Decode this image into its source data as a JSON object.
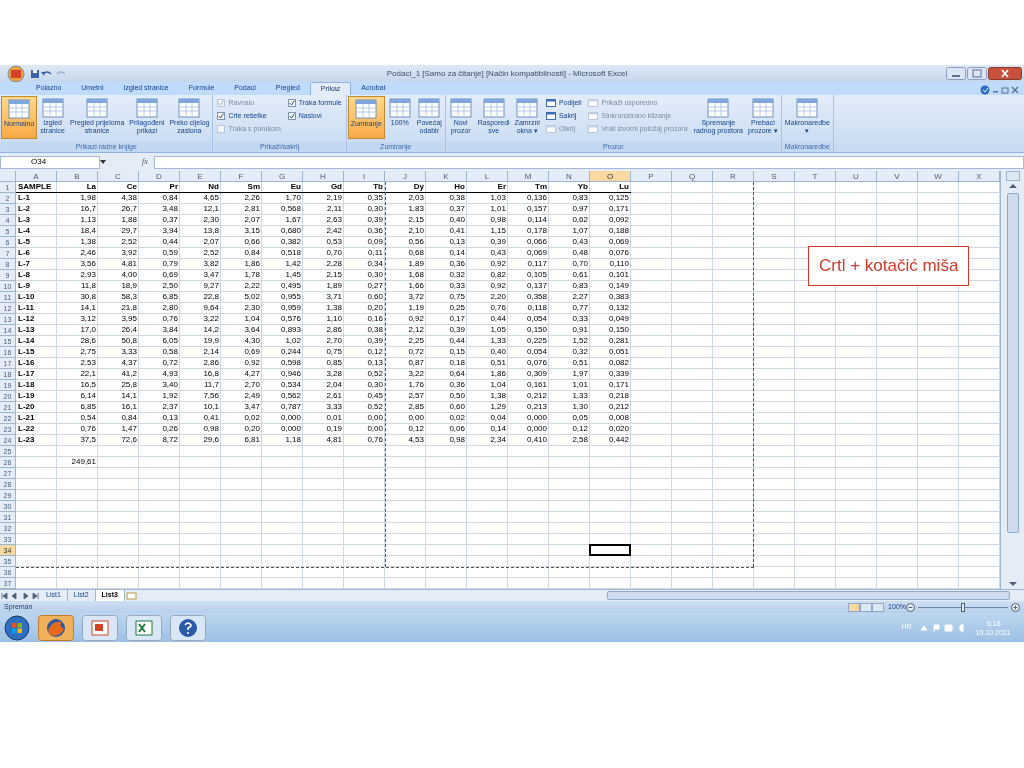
{
  "window": {
    "title": "Podaci_1  [Samo za čitanje]  [Način kompatibilnosti] - Microsoft Excel"
  },
  "tabs": [
    {
      "label": "Polazno",
      "selected": false
    },
    {
      "label": "Umetni",
      "selected": false
    },
    {
      "label": "Izgled stranice",
      "selected": false
    },
    {
      "label": "Formule",
      "selected": false
    },
    {
      "label": "Podaci",
      "selected": false
    },
    {
      "label": "Pregled",
      "selected": false
    },
    {
      "label": "Prikaz",
      "selected": true
    },
    {
      "label": "Acrobat",
      "selected": false
    }
  ],
  "ribbon": {
    "groups": [
      {
        "title": "Prikazi radne knjige",
        "items": [
          {
            "kind": "large",
            "lines": [
              "Normalno"
            ],
            "selected": true
          },
          {
            "kind": "large",
            "lines": [
              "Izgled",
              "stranice"
            ],
            "selected": false
          },
          {
            "kind": "large",
            "lines": [
              "Pregled prijeloma",
              "stranice"
            ],
            "selected": false
          },
          {
            "kind": "large",
            "lines": [
              "Prilagođeni",
              "prikazi"
            ],
            "selected": false
          },
          {
            "kind": "large",
            "lines": [
              "Preko cijelog",
              "zaslona"
            ],
            "selected": false
          }
        ]
      },
      {
        "title": "Prikaži/sakrij",
        "items": [
          {
            "kind": "stack",
            "items": [
              {
                "kind": "check",
                "label": "Ravnalo",
                "checked": true,
                "disabled": true
              },
              {
                "kind": "check",
                "label": "Crte rešetke",
                "checked": true,
                "disabled": false
              },
              {
                "kind": "check",
                "label": "Traka s porukom",
                "checked": false,
                "disabled": true
              }
            ]
          },
          {
            "kind": "stack",
            "items": [
              {
                "kind": "check",
                "label": "Traka formule",
                "checked": true,
                "disabled": false
              },
              {
                "kind": "check",
                "label": "Naslovi",
                "checked": true,
                "disabled": false
              }
            ]
          }
        ]
      },
      {
        "title": "Zumiranje",
        "items": [
          {
            "kind": "large",
            "lines": [
              "Zumiranje"
            ],
            "selected": true
          },
          {
            "kind": "large",
            "lines": [
              "100%"
            ],
            "selected": false
          },
          {
            "kind": "large",
            "lines": [
              "Povećaj",
              "odabir"
            ],
            "selected": false
          }
        ]
      },
      {
        "title": "Prozor",
        "items": [
          {
            "kind": "large",
            "lines": [
              "Novi",
              "prozor"
            ],
            "selected": false
          },
          {
            "kind": "large",
            "lines": [
              "Rasporedi",
              "sve"
            ],
            "selected": false
          },
          {
            "kind": "large",
            "lines": [
              "Zamrzni",
              "okna ▾"
            ],
            "selected": false
          },
          {
            "kind": "stack",
            "items": [
              {
                "kind": "small",
                "label": "Podijeli",
                "disabled": false
              },
              {
                "kind": "small",
                "label": "Sakrij",
                "disabled": false
              },
              {
                "kind": "small",
                "label": "Otkrij",
                "disabled": true
              }
            ]
          },
          {
            "kind": "stack",
            "items": [
              {
                "kind": "small",
                "label": "Prikaži usporedno",
                "disabled": true
              },
              {
                "kind": "small",
                "label": "Sinkronizirano klizanje",
                "disabled": true
              },
              {
                "kind": "small",
                "label": "Vrati izvorni položaj prozora",
                "disabled": true
              }
            ]
          },
          {
            "kind": "large",
            "lines": [
              "Spremanje",
              "radnog prostora"
            ],
            "selected": false
          },
          {
            "kind": "large",
            "lines": [
              "Prebaci",
              "prozore ▾"
            ],
            "selected": false
          }
        ]
      },
      {
        "title": "Makronaredbe",
        "items": [
          {
            "kind": "large",
            "lines": [
              "Makronaredbe",
              "▾"
            ],
            "selected": false
          }
        ]
      }
    ]
  },
  "formula_bar": {
    "name_box": "O34",
    "function_label": "fx"
  },
  "sheet": {
    "columns": [
      {
        "label": "A",
        "selected": false
      },
      {
        "label": "B",
        "selected": false
      },
      {
        "label": "C",
        "selected": false
      },
      {
        "label": "D",
        "selected": false
      },
      {
        "label": "E",
        "selected": false
      },
      {
        "label": "F",
        "selected": false
      },
      {
        "label": "G",
        "selected": false
      },
      {
        "label": "H",
        "selected": false
      },
      {
        "label": "I",
        "selected": false
      },
      {
        "label": "J",
        "selected": false
      },
      {
        "label": "K",
        "selected": false
      },
      {
        "label": "L",
        "selected": false
      },
      {
        "label": "M",
        "selected": false
      },
      {
        "label": "N",
        "selected": false
      },
      {
        "label": "O",
        "selected": true
      },
      {
        "label": "P",
        "selected": false
      },
      {
        "label": "Q",
        "selected": false
      },
      {
        "label": "R",
        "selected": false
      },
      {
        "label": "S",
        "selected": false
      },
      {
        "label": "T",
        "selected": false
      },
      {
        "label": "U",
        "selected": false
      },
      {
        "label": "V",
        "selected": false
      },
      {
        "label": "W",
        "selected": false
      },
      {
        "label": "X",
        "selected": false
      }
    ],
    "rows": [
      {
        "number": "1",
        "selected": false,
        "cells": [
          "SAMPLE",
          "La",
          "Ce",
          "Pr",
          "Nd",
          "Sm",
          "Eu",
          "Gd",
          "Tb",
          "Dy",
          "Ho",
          "Er",
          "Tm",
          "Yb",
          "Lu"
        ]
      },
      {
        "number": "2",
        "selected": false,
        "cells": [
          "L-1",
          "1,98",
          "4,38",
          "0,84",
          "4,65",
          "2,26",
          "1,70",
          "2,19",
          "0,35",
          "2,03",
          "0,38",
          "1,03",
          "0,136",
          "0,83",
          "0,125"
        ]
      },
      {
        "number": "3",
        "selected": false,
        "cells": [
          "L-2",
          "16,7",
          "26,7",
          "3,48",
          "12,1",
          "2,81",
          "0,568",
          "2,11",
          "0,30",
          "1,83",
          "0,37",
          "1,01",
          "0,157",
          "0,97",
          "0,171"
        ]
      },
      {
        "number": "4",
        "selected": false,
        "cells": [
          "L-3",
          "1,13",
          "1,88",
          "0,37",
          "2,30",
          "2,07",
          "1,67",
          "2,63",
          "0,39",
          "2,15",
          "0,40",
          "0,98",
          "0,114",
          "0,62",
          "0,092"
        ]
      },
      {
        "number": "5",
        "selected": false,
        "cells": [
          "L-4",
          "18,4",
          "29,7",
          "3,94",
          "13,8",
          "3,15",
          "0,680",
          "2,42",
          "0,36",
          "2,10",
          "0,41",
          "1,15",
          "0,178",
          "1,07",
          "0,188"
        ]
      },
      {
        "number": "6",
        "selected": false,
        "cells": [
          "L-5",
          "1,38",
          "2,52",
          "0,44",
          "2,07",
          "0,66",
          "0,382",
          "0,53",
          "0,09",
          "0,56",
          "0,13",
          "0,39",
          "0,066",
          "0,43",
          "0,069"
        ]
      },
      {
        "number": "7",
        "selected": false,
        "cells": [
          "L-6",
          "2,46",
          "3,92",
          "0,59",
          "2,52",
          "0,84",
          "0,518",
          "0,70",
          "0,11",
          "0,68",
          "0,14",
          "0,43",
          "0,069",
          "0,48",
          "0,076"
        ]
      },
      {
        "number": "8",
        "selected": false,
        "cells": [
          "L-7",
          "3,56",
          "4,81",
          "0,79",
          "3,82",
          "1,86",
          "1,42",
          "2,28",
          "0,34",
          "1,89",
          "0,36",
          "0,92",
          "0,117",
          "0,70",
          "0,110"
        ]
      },
      {
        "number": "9",
        "selected": false,
        "cells": [
          "L-8",
          "2,93",
          "4,00",
          "0,69",
          "3,47",
          "1,78",
          "1,45",
          "2,15",
          "0,30",
          "1,68",
          "0,32",
          "0,82",
          "0,105",
          "0,61",
          "0,101"
        ]
      },
      {
        "number": "10",
        "selected": false,
        "cells": [
          "L-9",
          "11,8",
          "18,9",
          "2,50",
          "9,27",
          "2,22",
          "0,495",
          "1,89",
          "0,27",
          "1,66",
          "0,33",
          "0,92",
          "0,137",
          "0,83",
          "0,149"
        ]
      },
      {
        "number": "11",
        "selected": false,
        "cells": [
          "L-10",
          "30,8",
          "58,3",
          "6,85",
          "22,8",
          "5,02",
          "0,955",
          "3,71",
          "0,60",
          "3,72",
          "0,75",
          "2,20",
          "0,358",
          "2,27",
          "0,383"
        ]
      },
      {
        "number": "12",
        "selected": false,
        "cells": [
          "L-11",
          "14,1",
          "21,8",
          "2,80",
          "9,64",
          "2,30",
          "0,959",
          "1,38",
          "0,20",
          "1,19",
          "0,25",
          "0,76",
          "0,118",
          "0,77",
          "0,132"
        ]
      },
      {
        "number": "13",
        "selected": false,
        "cells": [
          "L-12",
          "3,12",
          "3,95",
          "0,76",
          "3,22",
          "1,04",
          "0,576",
          "1,10",
          "0,16",
          "0,92",
          "0,17",
          "0,44",
          "0,054",
          "0,33",
          "0,049"
        ]
      },
      {
        "number": "14",
        "selected": false,
        "cells": [
          "L-13",
          "17,0",
          "26,4",
          "3,84",
          "14,2",
          "3,64",
          "0,893",
          "2,86",
          "0,38",
          "2,12",
          "0,39",
          "1,05",
          "0,150",
          "0,91",
          "0,150"
        ]
      },
      {
        "number": "15",
        "selected": false,
        "cells": [
          "L-14",
          "28,6",
          "50,8",
          "6,05",
          "19,9",
          "4,30",
          "1,02",
          "2,70",
          "0,39",
          "2,25",
          "0,44",
          "1,33",
          "0,225",
          "1,52",
          "0,281"
        ]
      },
      {
        "number": "16",
        "selected": false,
        "cells": [
          "L-15",
          "2,75",
          "3,33",
          "0,58",
          "2,14",
          "0,69",
          "0,244",
          "0,75",
          "0,12",
          "0,72",
          "0,15",
          "0,40",
          "0,054",
          "0,32",
          "0,051"
        ]
      },
      {
        "number": "17",
        "selected": false,
        "cells": [
          "L-16",
          "2,53",
          "4,37",
          "0,72",
          "2,86",
          "0,92",
          "0,598",
          "0,85",
          "0,13",
          "0,87",
          "0,18",
          "0,51",
          "0,076",
          "0,51",
          "0,082"
        ]
      },
      {
        "number": "18",
        "selected": false,
        "cells": [
          "L-17",
          "22,1",
          "41,2",
          "4,93",
          "16,8",
          "4,27",
          "0,946",
          "3,28",
          "0,52",
          "3,22",
          "0,64",
          "1,86",
          "0,309",
          "1,97",
          "0,339"
        ]
      },
      {
        "number": "19",
        "selected": false,
        "cells": [
          "L-18",
          "16,5",
          "25,8",
          "3,40",
          "11,7",
          "2,70",
          "0,534",
          "2,04",
          "0,30",
          "1,76",
          "0,36",
          "1,04",
          "0,161",
          "1,01",
          "0,171"
        ]
      },
      {
        "number": "20",
        "selected": false,
        "cells": [
          "L-19",
          "6,14",
          "14,1",
          "1,92",
          "7,56",
          "2,49",
          "0,562",
          "2,61",
          "0,45",
          "2,57",
          "0,50",
          "1,38",
          "0,212",
          "1,33",
          "0,218"
        ]
      },
      {
        "number": "21",
        "selected": false,
        "cells": [
          "L-20",
          "6,85",
          "16,1",
          "2,37",
          "10,1",
          "3,47",
          "0,787",
          "3,33",
          "0,52",
          "2,85",
          "0,60",
          "1,29",
          "0,213",
          "1,30",
          "0,212"
        ]
      },
      {
        "number": "22",
        "selected": false,
        "cells": [
          "L-21",
          "0,54",
          "0,84",
          "0,13",
          "0,41",
          "0,02",
          "0,000",
          "0,01",
          "0,00",
          "0,00",
          "0,02",
          "0,04",
          "0,000",
          "0,05",
          "0,008"
        ]
      },
      {
        "number": "23",
        "selected": false,
        "cells": [
          "L-22",
          "0,76",
          "1,47",
          "0,26",
          "0,98",
          "0,20",
          "0,000",
          "0,19",
          "0,00",
          "0,12",
          "0,06",
          "0,14",
          "0,000",
          "0,12",
          "0,020"
        ]
      },
      {
        "number": "24",
        "selected": false,
        "cells": [
          "L-23",
          "37,5",
          "72,6",
          "8,72",
          "29,6",
          "6,81",
          "1,18",
          "4,81",
          "0,76",
          "4,53",
          "0,98",
          "2,34",
          "0,410",
          "2,58",
          "0,442"
        ]
      },
      {
        "number": "25",
        "selected": false
      },
      {
        "number": "26",
        "selected": false,
        "cells": [
          null,
          "249,61"
        ]
      },
      {
        "number": "27",
        "selected": false
      },
      {
        "number": "28",
        "selected": false
      },
      {
        "number": "29",
        "selected": false
      },
      {
        "number": "30",
        "selected": false
      },
      {
        "number": "31",
        "selected": false
      },
      {
        "number": "32",
        "selected": false
      },
      {
        "number": "33",
        "selected": false
      },
      {
        "number": "34",
        "selected": true
      },
      {
        "number": "35",
        "selected": false
      },
      {
        "number": "36",
        "selected": false
      },
      {
        "number": "37",
        "selected": false
      }
    ]
  },
  "sheet_tabs": [
    {
      "label": "List1",
      "selected": false
    },
    {
      "label": "List2",
      "selected": false
    },
    {
      "label": "List3",
      "selected": true
    }
  ],
  "status_bar": {
    "status": "Spreman",
    "zoom": "100%",
    "zoom_slider": {
      "level": 0.5
    }
  },
  "taskbar": {
    "language": "HR",
    "time": "6:18",
    "date": "10.10.2011."
  },
  "callout": {
    "text": "Crtl + kotačić miša"
  }
}
